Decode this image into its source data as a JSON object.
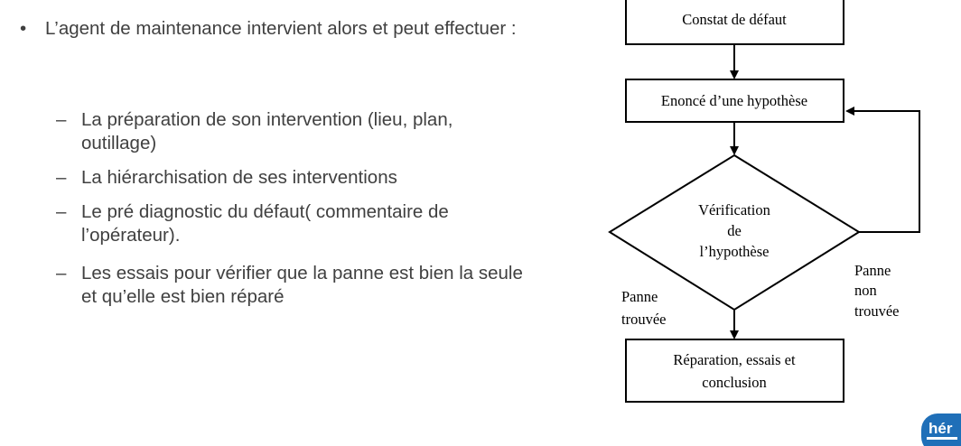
{
  "content": {
    "bullet": "L’agent de maintenance intervient alors et peut effectuer :",
    "sub_items": [
      "La préparation de son intervention (lieu, plan, outillage)",
      "La hiérarchisation de ses interventions",
      "Le pré diagnostic du défaut( commentaire de l’opérateur).",
      "Les essais pour vérifier que la panne est bien la seule et qu’elle est bien réparé"
    ]
  },
  "flowchart": {
    "box_constat": "Constat de défaut",
    "box_enonce": "Enoncé d’une hypothèse",
    "decision_line1": "Vérification",
    "decision_line2": "de",
    "decision_line3": "l’hypothèse",
    "label_found_line1": "Panne",
    "label_found_line2": "trouvée",
    "label_notfound_line1": "Panne",
    "label_notfound_line2": "non",
    "label_notfound_line3": "trouvée",
    "box_reparation_line1": "Réparation, essais et",
    "box_reparation_line2": "conclusion"
  },
  "logo": {
    "text": "hér",
    "color": "#1f6fb8"
  }
}
